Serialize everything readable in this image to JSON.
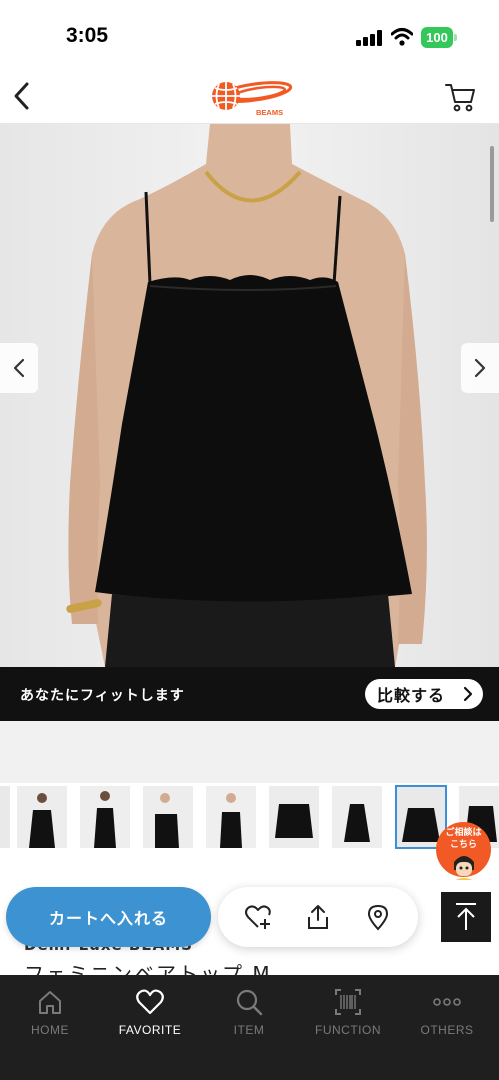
{
  "status_bar": {
    "time": "3:05",
    "battery": "100"
  },
  "header": {
    "logo_text": "BEAMS"
  },
  "fit_bar": {
    "message": "あなたにフィットします",
    "compare_label": "比較する"
  },
  "consult_badge": {
    "line1": "ご相談は",
    "line2": "こちら"
  },
  "actions": {
    "add_to_cart": "カートへ入れる",
    "brand_peek": "Demi-Luxe BEAMS",
    "product_peek": "フェミニンベアトップ M"
  },
  "tabs": [
    {
      "label": "HOME",
      "icon": "home-icon"
    },
    {
      "label": "FAVORITE",
      "icon": "heart-icon"
    },
    {
      "label": "ITEM",
      "icon": "search-icon"
    },
    {
      "label": "FUNCTION",
      "icon": "barcode-icon"
    },
    {
      "label": "OTHERS",
      "icon": "more-dots-icon"
    }
  ],
  "colors": {
    "accent_blue": "#3d93d1",
    "brand_orange": "#f15a24",
    "tab_bar": "#1f1f1f",
    "battery_green": "#34c759"
  }
}
